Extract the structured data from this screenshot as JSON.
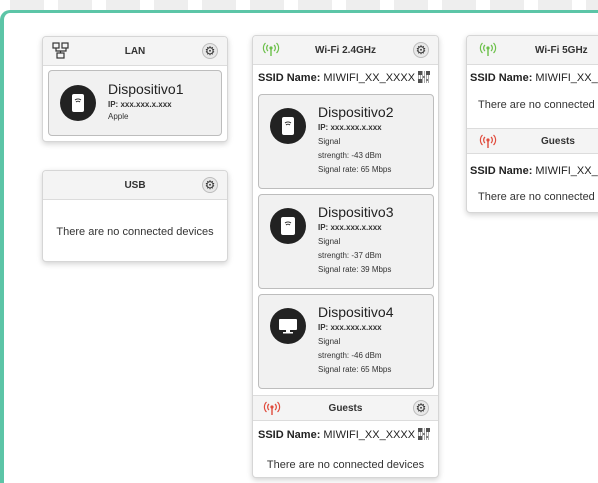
{
  "lan": {
    "title": "LAN",
    "device": {
      "name": "Dispositivo1",
      "ip": "IP: xxx.xxx.x.xxx",
      "vendor": "Apple",
      "icon": "phone-icon"
    }
  },
  "usb": {
    "title": "USB",
    "empty_text": "There are no connected devices"
  },
  "wifi24": {
    "title": "Wi-Fi 2.4GHz",
    "ssid_label": "SSID Name:",
    "ssid_value": "MIWIFI_XX_XXXX",
    "devices": [
      {
        "name": "Dispositivo2",
        "ip": "IP: xxx.xxx.x.xxx",
        "signal_label": "Signal",
        "strength": "strength: -43 dBm",
        "rate": "Signal rate: 65 Mbps",
        "icon": "phone-icon"
      },
      {
        "name": "Dispositivo3",
        "ip": "IP: xxx.xxx.x.xxx",
        "signal_label": "Signal",
        "strength": "strength: -37 dBm",
        "rate": "Signal rate: 39 Mbps",
        "icon": "tablet-icon"
      },
      {
        "name": "Dispositivo4",
        "ip": "IP: xxx.xxx.x.xxx",
        "signal_label": "Signal",
        "strength": "strength: -46 dBm",
        "rate": "Signal rate: 65 Mbps",
        "icon": "monitor-icon"
      }
    ],
    "guests": {
      "title": "Guests",
      "ssid_label": "SSID Name:",
      "ssid_value": "MIWIFI_XX_XXXX",
      "empty_text": "There are no connected devices"
    }
  },
  "wifi5": {
    "title": "Wi-Fi 5GHz",
    "ssid_label": "SSID Name:",
    "ssid_value": "MIWIFI_XX_X",
    "empty_text": "There are no connected",
    "guests": {
      "title": "Guests",
      "ssid_label": "SSID Name:",
      "ssid_value": "MIWIFI_XX_X",
      "empty_text": "There are no connected"
    }
  },
  "colors": {
    "accent_frame": "#5cc5a7",
    "wifi_on": "#6cc04a",
    "guests_red": "#e04b3c"
  }
}
